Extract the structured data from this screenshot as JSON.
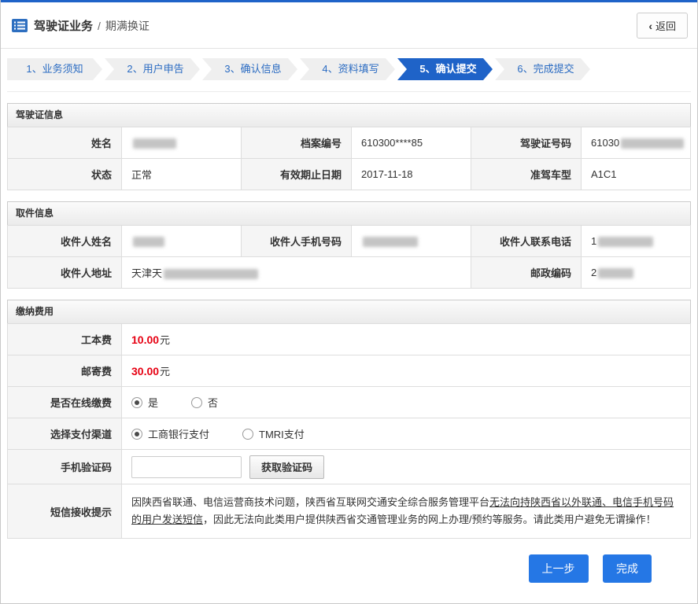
{
  "header": {
    "title": "驾驶证业务",
    "separator": "/",
    "subtitle": "期满换证",
    "back_chevron": "‹",
    "back_label": "返回"
  },
  "steps": {
    "active_index": 4,
    "items": [
      {
        "label": "1、业务须知"
      },
      {
        "label": "2、用户申告"
      },
      {
        "label": "3、确认信息"
      },
      {
        "label": "4、资料填写"
      },
      {
        "label": "5、确认提交"
      },
      {
        "label": "6、完成提交"
      }
    ]
  },
  "license_info": {
    "title": "驾驶证信息",
    "row1": {
      "c1_label": "姓名",
      "c1_value": "",
      "c2_label": "档案编号",
      "c2_value": "610300****85",
      "c3_label": "驾驶证号码",
      "c3_value": "61030"
    },
    "row2": {
      "c1_label": "状态",
      "c1_value": "正常",
      "c2_label": "有效期止日期",
      "c2_value": "2017-11-18",
      "c3_label": "准驾车型",
      "c3_value": "A1C1"
    }
  },
  "pickup_info": {
    "title": "取件信息",
    "row1": {
      "c1_label": "收件人姓名",
      "c1_value": "",
      "c2_label": "收件人手机号码",
      "c2_value": "",
      "c3_label": "收件人联系电话",
      "c3_value": "1"
    },
    "row2": {
      "c1_label": "收件人地址",
      "c1_value": "天津天",
      "c2_label": "邮政编码",
      "c2_value": "2"
    }
  },
  "payment": {
    "title": "缴纳费用",
    "fee1_label": "工本费",
    "fee1_amount": "10.00",
    "fee1_unit": "元",
    "fee2_label": "邮寄费",
    "fee2_amount": "30.00",
    "fee2_unit": "元",
    "online_label": "是否在线缴费",
    "online_options": [
      {
        "label": "是",
        "checked": true
      },
      {
        "label": "否",
        "checked": false
      }
    ],
    "channel_label": "选择支付渠道",
    "channel_options": [
      {
        "label": "工商银行支付",
        "checked": true
      },
      {
        "label": "TMRI支付",
        "checked": false
      }
    ],
    "code_label": "手机验证码",
    "code_value": "",
    "code_button": "获取验证码",
    "sms_label": "短信接收提示",
    "sms_part1": "因陕西省联通、电信运营商技术问题，陕西省互联网交通安全综合服务管理平台",
    "sms_part2": "无法向持陕西省以外联通、电信手机号码的用户发送短信",
    "sms_part3": "，因此无法向此类用户提供陕西省交通管理业务的网上办理/预约等服务。请此类用户避免无谓操作！"
  },
  "footer": {
    "prev_label": "上一步",
    "finish_label": "完成"
  },
  "colors": {
    "accent_blue": "#1f63c8",
    "active_step_bg": "#1f63c8",
    "danger_red": "#e60012",
    "button_blue": "#2577e5"
  }
}
